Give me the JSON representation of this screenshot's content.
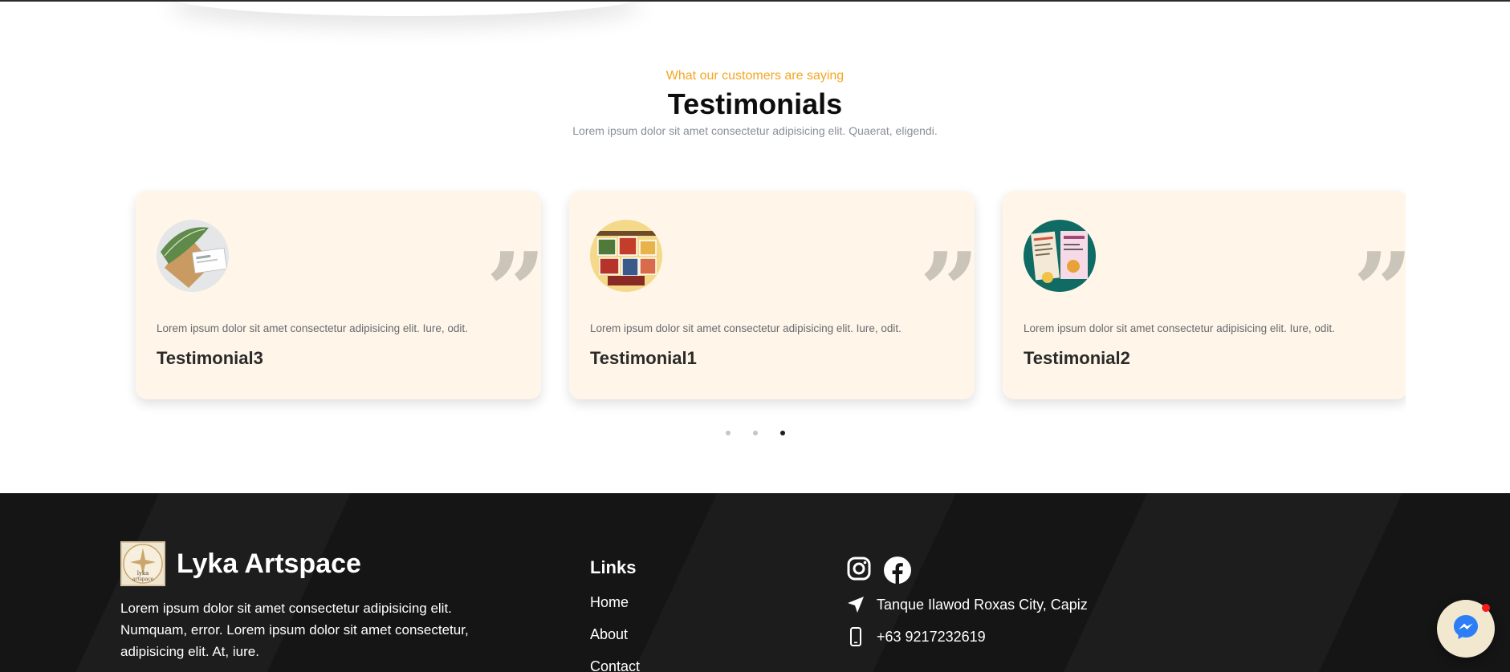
{
  "testimonials_section": {
    "kicker": "What our customers are saying",
    "title": "Testimonials",
    "subtitle": "Lorem ipsum dolor sit amet consectetur adipisicing elit. Quaerat, eligendi."
  },
  "cards": [
    {
      "name": "Testimonial3",
      "text": "Lorem ipsum dolor sit amet consectetur adipisicing elit. Iure, odit.",
      "quote_mark": "”",
      "avatar": "business-card-leaf-image"
    },
    {
      "name": "Testimonial1",
      "text": "Lorem ipsum dolor sit amet consectetur adipisicing elit. Iure, odit.",
      "quote_mark": "”",
      "avatar": "photo-collage-image"
    },
    {
      "name": "Testimonial2",
      "text": "Lorem ipsum dolor sit amet consectetur adipisicing elit. Iure, odit.",
      "quote_mark": "”",
      "avatar": "menu-flyer-image"
    }
  ],
  "carousel": {
    "slide_count": 3,
    "active_slide": 3
  },
  "footer": {
    "brand_name": "Lyka Artspace",
    "logo_text_1": "lyka",
    "logo_text_2": "artspace",
    "about": "Lorem ipsum dolor sit amet consectetur adipisicing elit. Numquam, error. Lorem ipsum dolor sit amet consectetur, adipisicing elit. At, iure.",
    "links_title": "Links",
    "links": [
      "Home",
      "About",
      "Contact"
    ],
    "social_icons": [
      "instagram-icon",
      "facebook-icon"
    ],
    "address": "Tanque Ilawod Roxas City, Capiz",
    "phone": "+63 9217232619"
  },
  "colors": {
    "accent": "#f5a623",
    "card_bg": "#fff5e8",
    "footer_bg": "#151515",
    "chat_badge": "#ff1a1a",
    "messenger_blue": "#2d7df6"
  }
}
